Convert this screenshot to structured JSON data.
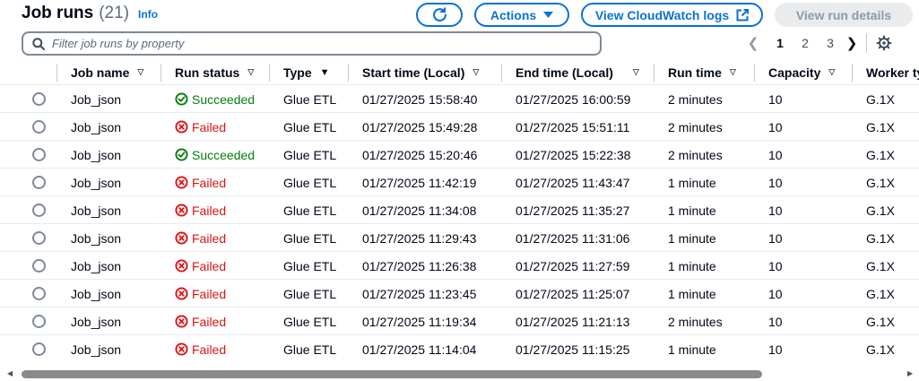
{
  "header": {
    "title": "Job runs",
    "count": "(21)",
    "info": "Info"
  },
  "toolbar": {
    "actions_label": "Actions",
    "cloudwatch_label": "View CloudWatch logs",
    "view_details_label": "View run details"
  },
  "filter": {
    "placeholder": "Filter job runs by property",
    "value": ""
  },
  "pagination": {
    "pages": [
      "1",
      "2",
      "3"
    ],
    "current": "1"
  },
  "columns": [
    "Job name",
    "Run status",
    "Type",
    "Start time (Local)",
    "End time (Local)",
    "Run time",
    "Capacity",
    "Worker ty"
  ],
  "rows": [
    {
      "job_name": "Job_json",
      "status": "Succeeded",
      "type": "Glue ETL",
      "start": "01/27/2025 15:58:40",
      "end": "01/27/2025 16:00:59",
      "run_time": "2 minutes",
      "capacity": "10",
      "worker": "G.1X"
    },
    {
      "job_name": "Job_json",
      "status": "Failed",
      "type": "Glue ETL",
      "start": "01/27/2025 15:49:28",
      "end": "01/27/2025 15:51:11",
      "run_time": "2 minutes",
      "capacity": "10",
      "worker": "G.1X"
    },
    {
      "job_name": "Job_json",
      "status": "Succeeded",
      "type": "Glue ETL",
      "start": "01/27/2025 15:20:46",
      "end": "01/27/2025 15:22:38",
      "run_time": "2 minutes",
      "capacity": "10",
      "worker": "G.1X"
    },
    {
      "job_name": "Job_json",
      "status": "Failed",
      "type": "Glue ETL",
      "start": "01/27/2025 11:42:19",
      "end": "01/27/2025 11:43:47",
      "run_time": "1 minute",
      "capacity": "10",
      "worker": "G.1X"
    },
    {
      "job_name": "Job_json",
      "status": "Failed",
      "type": "Glue ETL",
      "start": "01/27/2025 11:34:08",
      "end": "01/27/2025 11:35:27",
      "run_time": "1 minute",
      "capacity": "10",
      "worker": "G.1X"
    },
    {
      "job_name": "Job_json",
      "status": "Failed",
      "type": "Glue ETL",
      "start": "01/27/2025 11:29:43",
      "end": "01/27/2025 11:31:06",
      "run_time": "1 minute",
      "capacity": "10",
      "worker": "G.1X"
    },
    {
      "job_name": "Job_json",
      "status": "Failed",
      "type": "Glue ETL",
      "start": "01/27/2025 11:26:38",
      "end": "01/27/2025 11:27:59",
      "run_time": "1 minute",
      "capacity": "10",
      "worker": "G.1X"
    },
    {
      "job_name": "Job_json",
      "status": "Failed",
      "type": "Glue ETL",
      "start": "01/27/2025 11:23:45",
      "end": "01/27/2025 11:25:07",
      "run_time": "1 minute",
      "capacity": "10",
      "worker": "G.1X"
    },
    {
      "job_name": "Job_json",
      "status": "Failed",
      "type": "Glue ETL",
      "start": "01/27/2025 11:19:34",
      "end": "01/27/2025 11:21:13",
      "run_time": "2 minutes",
      "capacity": "10",
      "worker": "G.1X"
    },
    {
      "job_name": "Job_json",
      "status": "Failed",
      "type": "Glue ETL",
      "start": "01/27/2025 11:14:04",
      "end": "01/27/2025 11:15:25",
      "run_time": "1 minute",
      "capacity": "10",
      "worker": "G.1X"
    }
  ],
  "colors": {
    "link": "#0972d3",
    "success": "#037f0c",
    "error": "#d91515"
  }
}
